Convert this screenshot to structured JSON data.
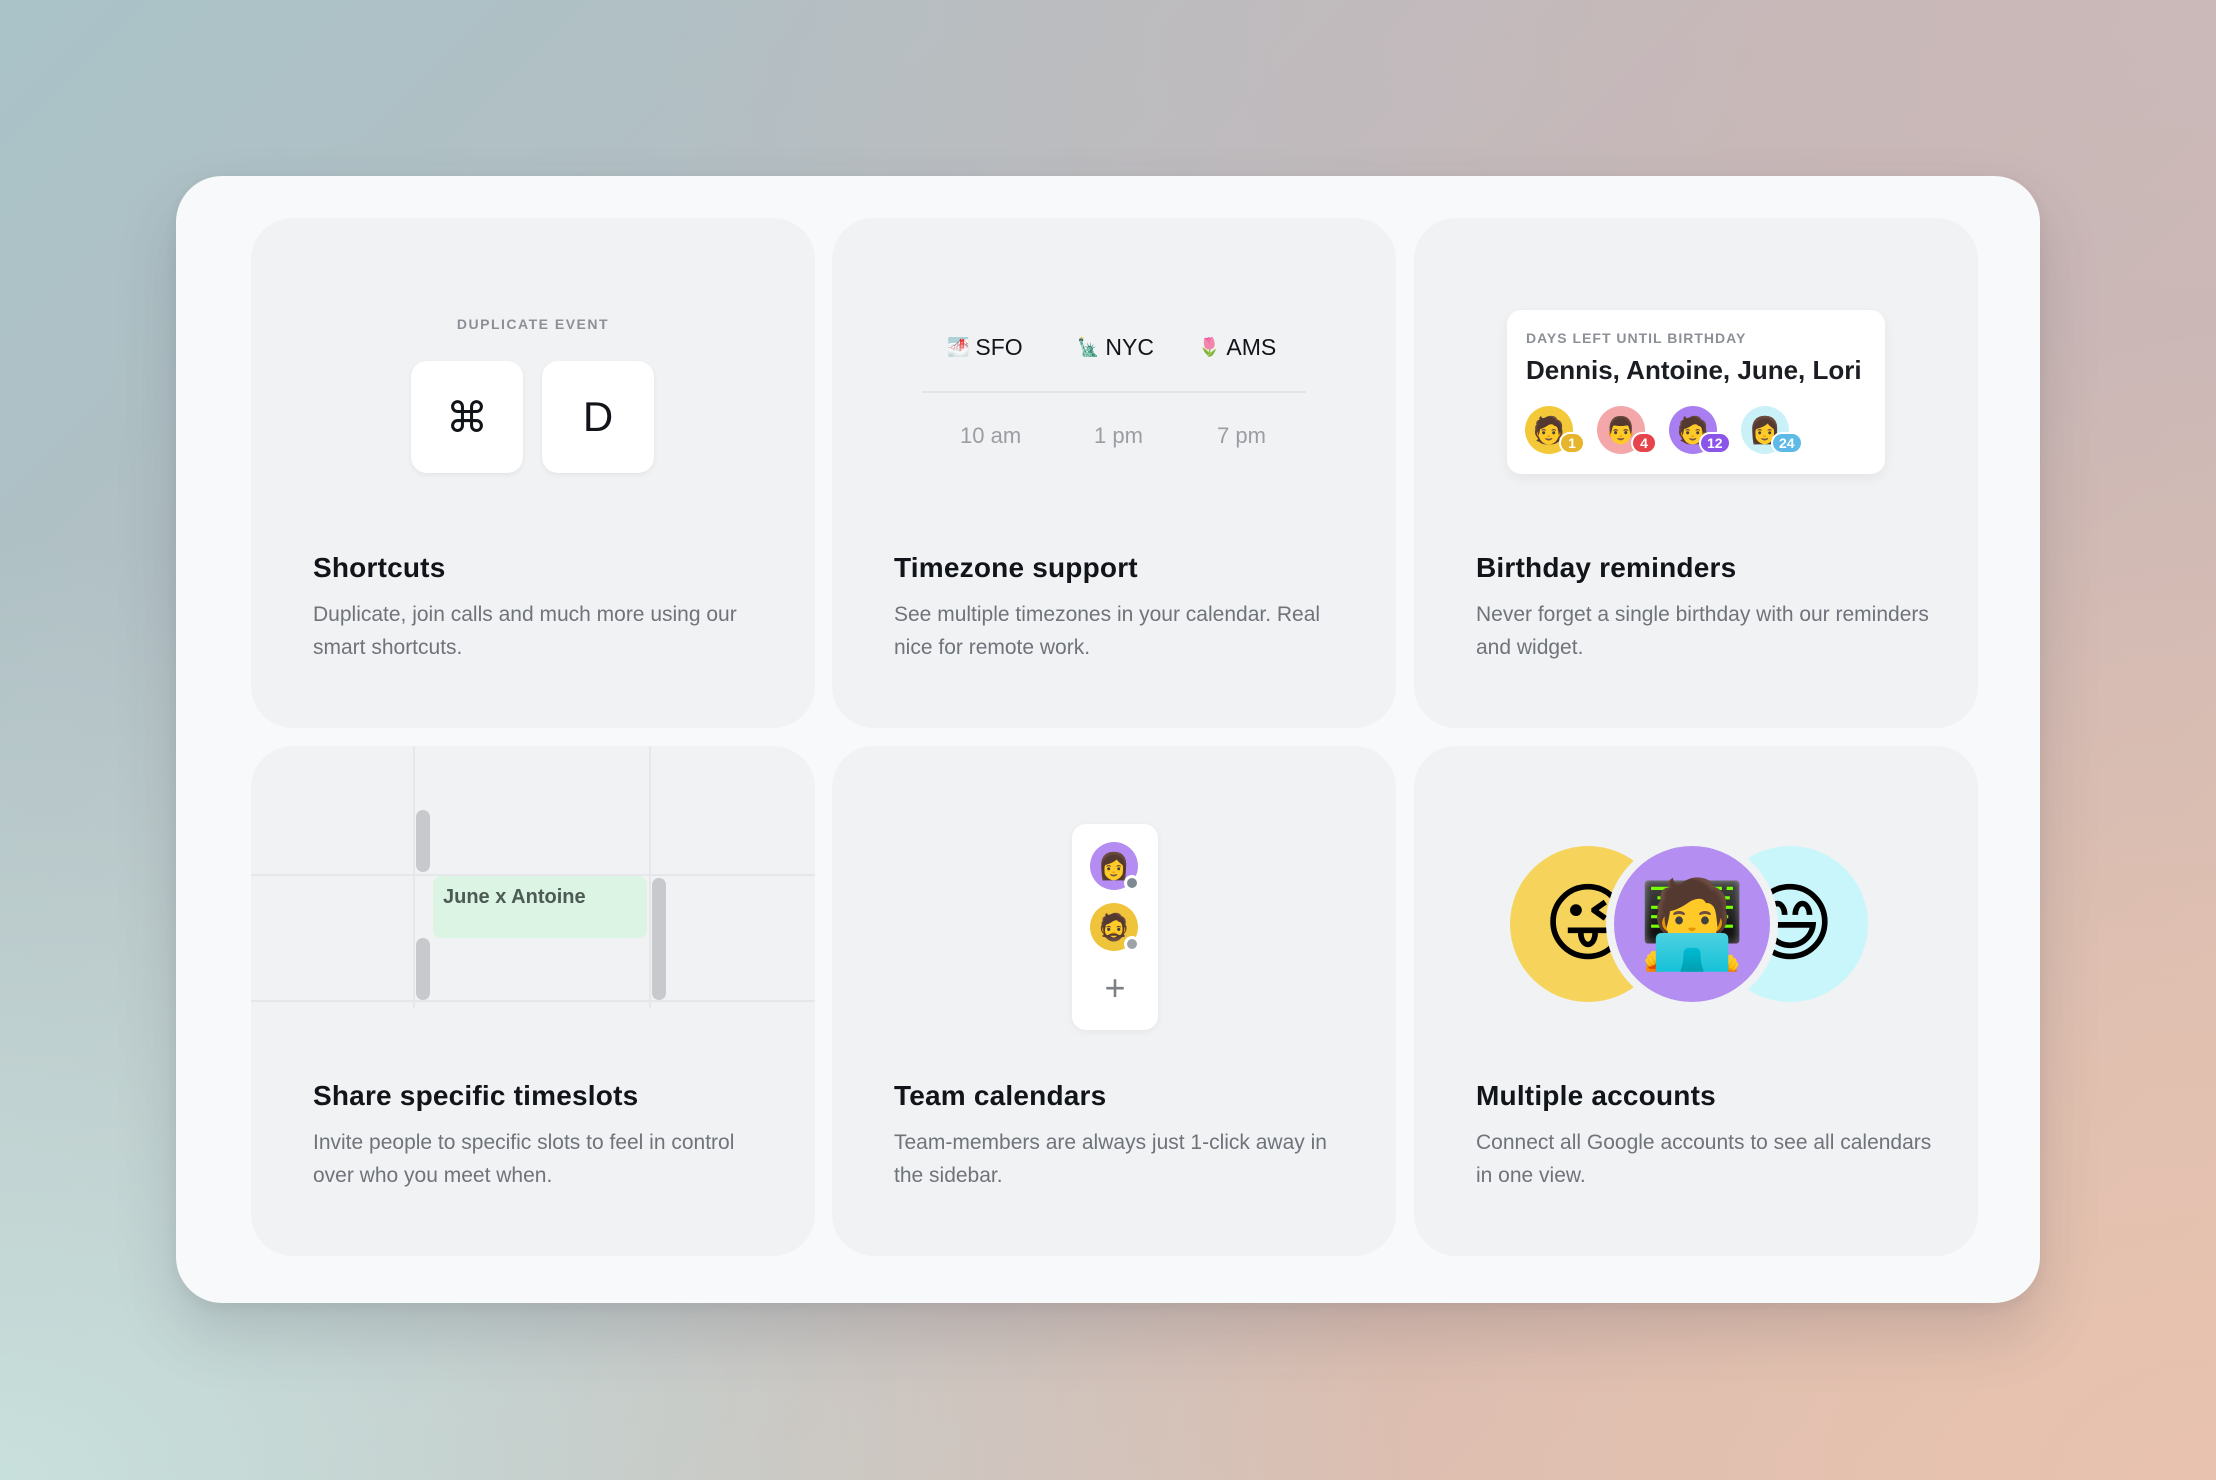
{
  "cards": {
    "shortcuts": {
      "label": "DUPLICATE EVENT",
      "key1": "⌘",
      "key2": "D",
      "title": "Shortcuts",
      "desc": "Duplicate, join calls and much more using our smart shortcuts."
    },
    "timezone": {
      "zones": [
        {
          "flag": "🌁",
          "label": "SFO",
          "time": "10 am"
        },
        {
          "flag": "🗽",
          "label": "NYC",
          "time": "1 pm"
        },
        {
          "flag": "🌷",
          "label": "AMS",
          "time": "7 pm"
        }
      ],
      "title": "Timezone support",
      "desc": "See multiple timezones in your calendar. Real nice for remote work."
    },
    "birthday": {
      "label": "DAYS LEFT UNTIL BIRTHDAY",
      "names": "Dennis, Antoine, June, Lori",
      "avatars": [
        {
          "emoji": "🧑",
          "days": "1"
        },
        {
          "emoji": "👨",
          "days": "4"
        },
        {
          "emoji": "🧑",
          "days": "12"
        },
        {
          "emoji": "👩",
          "days": "24"
        }
      ],
      "title": "Birthday reminders",
      "desc": "Never forget a single birthday with our reminders and widget."
    },
    "timeslots": {
      "event": "June x Antoine",
      "title": "Share specific timeslots",
      "desc": "Invite people to specific slots to feel in control over who you meet when."
    },
    "team": {
      "members": [
        {
          "emoji": "👩"
        },
        {
          "emoji": "🧔"
        }
      ],
      "add": "+",
      "title": "Team calendars",
      "desc": "Team-members are always just 1-click away in the sidebar."
    },
    "accounts": {
      "avatars": [
        {
          "emoji": "😜"
        },
        {
          "emoji": "🧑‍💻"
        },
        {
          "emoji": "😄"
        }
      ],
      "title": "Multiple accounts",
      "desc": "Connect all Google accounts to see all calendars in one view."
    }
  }
}
